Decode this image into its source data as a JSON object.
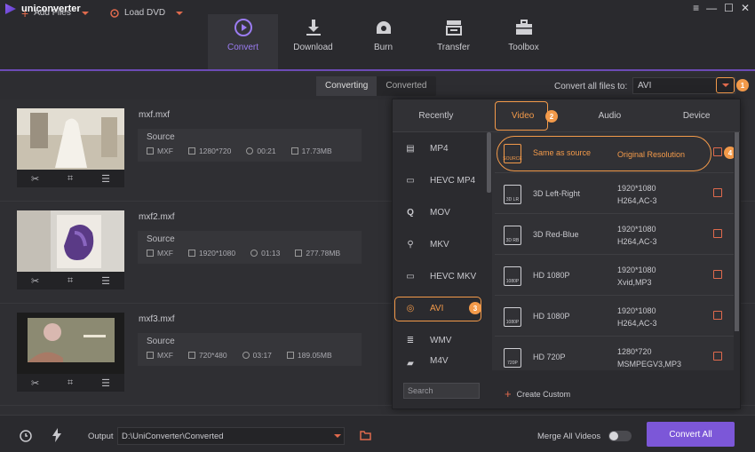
{
  "app": {
    "name": "uniconverter",
    "window_controls": [
      "≡",
      "—",
      "☐",
      "✕"
    ]
  },
  "nav": [
    {
      "label": "Convert",
      "icon": "convert-icon",
      "active": true
    },
    {
      "label": "Download",
      "icon": "download-icon",
      "active": false
    },
    {
      "label": "Burn",
      "icon": "burn-icon",
      "active": false
    },
    {
      "label": "Transfer",
      "icon": "transfer-icon",
      "active": false
    },
    {
      "label": "Toolbox",
      "icon": "toolbox-icon",
      "active": false
    }
  ],
  "toolbar": {
    "add_files": "Add Files",
    "load_dvd": "Load DVD",
    "tabs": [
      "Converting",
      "Converted"
    ],
    "convert_all_to_label": "Convert all files to:",
    "format_value": "AVI"
  },
  "badges": [
    "1",
    "2",
    "3",
    "4"
  ],
  "files": [
    {
      "name": "mxf.mxf",
      "source_label": "Source",
      "format": "MXF",
      "resolution": "1280*720",
      "duration": "00:21",
      "size": "17.73MB"
    },
    {
      "name": "mxf2.mxf",
      "source_label": "Source",
      "format": "MXF",
      "resolution": "1920*1080",
      "duration": "01:13",
      "size": "277.78MB"
    },
    {
      "name": "mxf3.mxf",
      "source_label": "Source",
      "format": "MXF",
      "resolution": "720*480",
      "duration": "03:17",
      "size": "189.05MB"
    }
  ],
  "panel": {
    "tabs": [
      "Recently",
      "Video",
      "Audio",
      "Device"
    ],
    "selected_tab": "Video",
    "formats": [
      "MP4",
      "HEVC MP4",
      "MOV",
      "MKV",
      "HEVC MKV",
      "AVI",
      "WMV",
      "M4V"
    ],
    "selected_format": "AVI",
    "presets": [
      {
        "name": "Same as source",
        "res": "Original Resolution",
        "codec": "",
        "icon_text": "SOURCE"
      },
      {
        "name": "3D Left-Right",
        "res": "1920*1080",
        "codec": "H264,AC-3",
        "icon_text": "3D LR"
      },
      {
        "name": "3D Red-Blue",
        "res": "1920*1080",
        "codec": "H264,AC-3",
        "icon_text": "3D RB"
      },
      {
        "name": "HD 1080P",
        "res": "1920*1080",
        "codec": "Xvid,MP3",
        "icon_text": "1080P"
      },
      {
        "name": "HD 1080P",
        "res": "1920*1080",
        "codec": "H264,AC-3",
        "icon_text": "1080P"
      },
      {
        "name": "HD 720P",
        "res": "1280*720",
        "codec": "MSMPEGV3,MP3",
        "icon_text": "720P"
      }
    ],
    "search_placeholder": "Search",
    "create_custom": "Create Custom"
  },
  "bottom": {
    "output_label": "Output",
    "output_path": "D:\\UniConverter\\Converted",
    "merge_label": "Merge All Videos",
    "merge_on": false,
    "convert_all": "Convert All"
  },
  "colors": {
    "accent": "#7c57d8",
    "highlight": "#f39a4a",
    "edit": "#e06a4d"
  }
}
